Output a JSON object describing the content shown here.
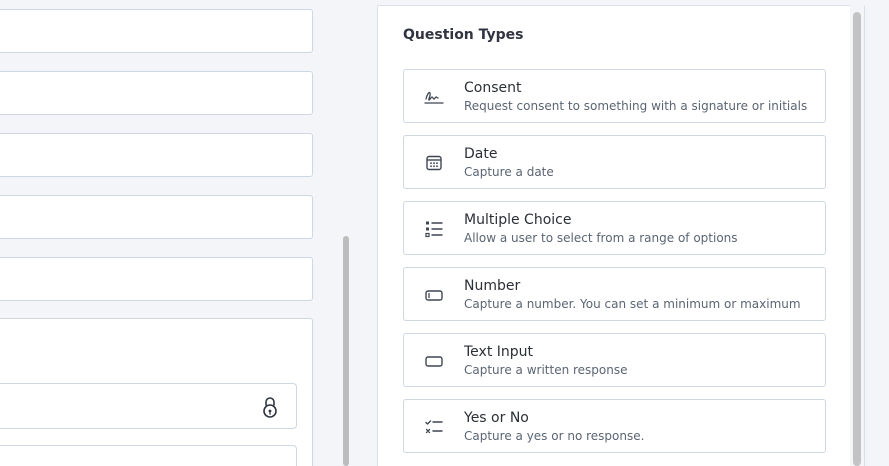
{
  "panel": {
    "title": "Question Types",
    "items": [
      {
        "title": "Consent",
        "description": "Request consent to something with a signature or initials",
        "icon": "signature-icon"
      },
      {
        "title": "Date",
        "description": "Capture a date",
        "icon": "calendar-icon"
      },
      {
        "title": "Multiple Choice",
        "description": "Allow a user to select from a range of options",
        "icon": "list-options-icon"
      },
      {
        "title": "Number",
        "description": "Capture a number. You can set a minimum or maximum",
        "icon": "number-input-icon"
      },
      {
        "title": "Text Input",
        "description": "Capture a written response",
        "icon": "text-input-icon"
      },
      {
        "title": "Yes or No",
        "description": "Capture a yes or no response.",
        "icon": "yes-no-icon"
      }
    ]
  },
  "colors": {
    "background": "#f3f5f8",
    "panel_border": "#d9e0ea",
    "field_border": "#cfd7e2",
    "title_text": "#2f3440",
    "description_text": "#5b6573",
    "scrollbar_thumb": "#c3c3c3"
  }
}
